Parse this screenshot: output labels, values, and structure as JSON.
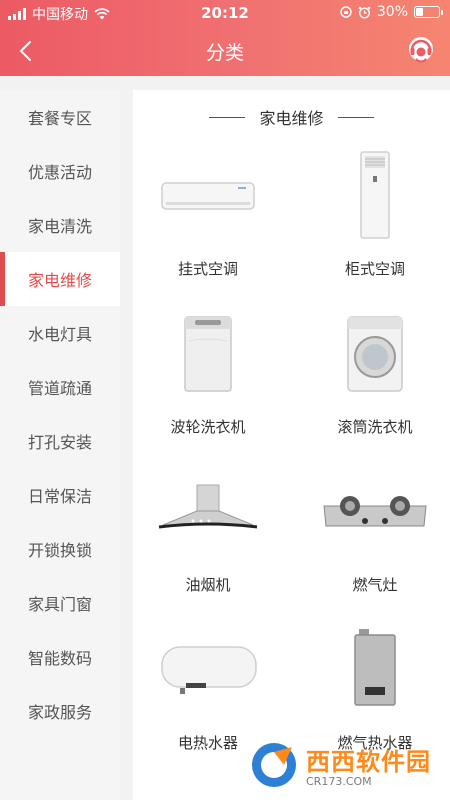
{
  "status": {
    "carrier": "中国移动",
    "time": "20:12",
    "battery": "30%"
  },
  "nav": {
    "title": "分类",
    "back_icon": "chevron-left-icon",
    "service_icon": "customer-service-icon"
  },
  "sidebar": {
    "items": [
      {
        "label": "套餐专区"
      },
      {
        "label": "优惠活动"
      },
      {
        "label": "家电清洗"
      },
      {
        "label": "家电维修",
        "active": true
      },
      {
        "label": "水电灯具"
      },
      {
        "label": "管道疏通"
      },
      {
        "label": "打孔安装"
      },
      {
        "label": "日常保洁"
      },
      {
        "label": "开锁换锁"
      },
      {
        "label": "家具门窗"
      },
      {
        "label": "智能数码"
      },
      {
        "label": "家政服务"
      }
    ]
  },
  "main": {
    "section_title": "家电维修",
    "products": [
      {
        "label": "挂式空调",
        "icon": "wall-air-conditioner-icon"
      },
      {
        "label": "柜式空调",
        "icon": "floor-air-conditioner-icon"
      },
      {
        "label": "波轮洗衣机",
        "icon": "top-load-washer-icon"
      },
      {
        "label": "滚筒洗衣机",
        "icon": "front-load-washer-icon"
      },
      {
        "label": "油烟机",
        "icon": "range-hood-icon"
      },
      {
        "label": "燃气灶",
        "icon": "gas-stove-icon"
      },
      {
        "label": "电热水器",
        "icon": "electric-water-heater-icon"
      },
      {
        "label": "燃气热水器",
        "icon": "gas-water-heater-icon"
      }
    ]
  },
  "watermark": {
    "title": "西西软件园",
    "subtitle": "CR173.COM"
  },
  "colors": {
    "header_start": "#ec5a63",
    "header_end": "#f58570",
    "accent": "#e24c4c"
  }
}
